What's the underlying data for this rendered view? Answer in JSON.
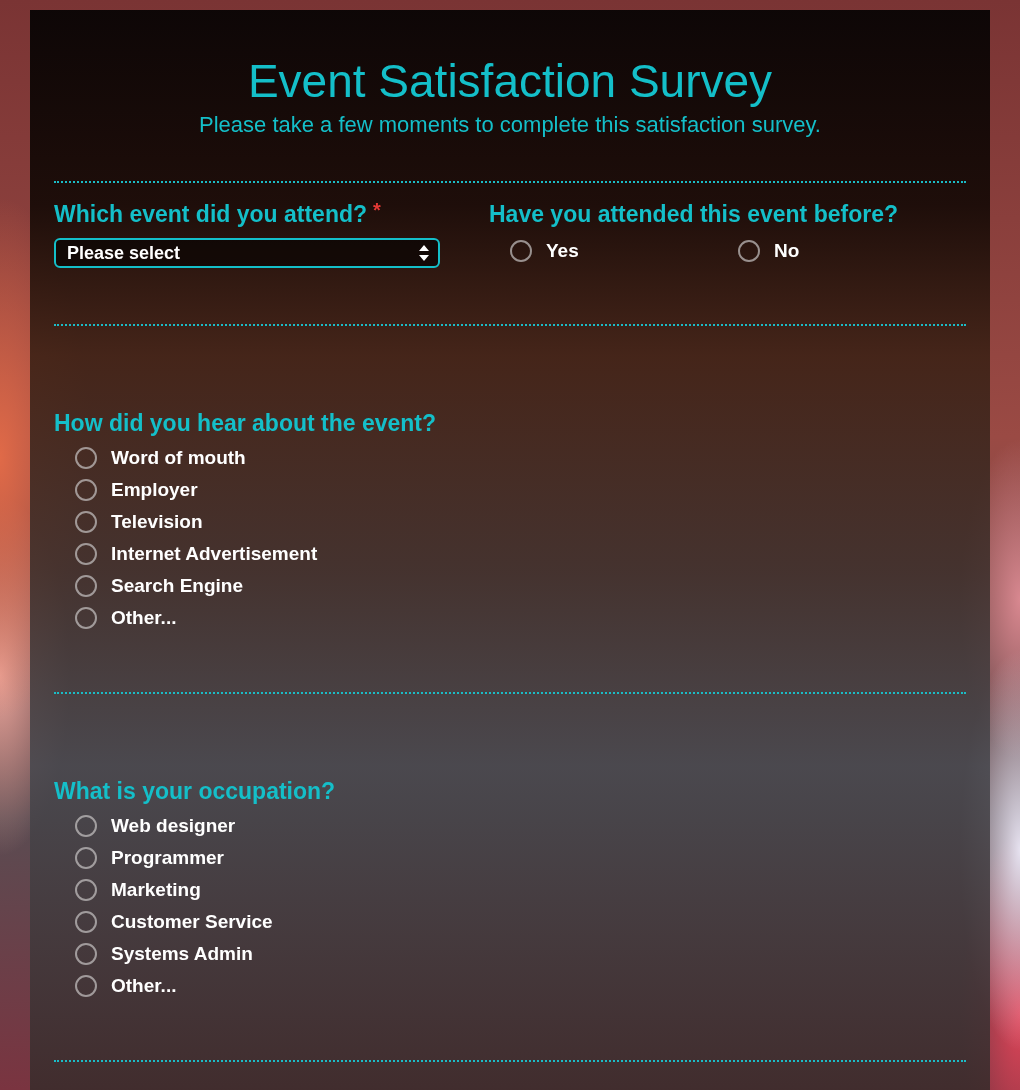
{
  "form": {
    "title": "Event Satisfaction Survey",
    "subtitle": "Please take a few moments to complete this satisfaction survey.",
    "sections": [
      {
        "questions": [
          {
            "kind": "select",
            "label": "Which event did you attend?",
            "required_mark": "*",
            "select": {
              "value": "Please select"
            }
          },
          {
            "kind": "radio_inline",
            "label": "Have you attended this event before?",
            "options": [
              {
                "label": "Yes",
                "selected": false
              },
              {
                "label": "No",
                "selected": false
              }
            ]
          }
        ]
      },
      {
        "questions": [
          {
            "kind": "radio_list",
            "label": "How did you hear about the event?",
            "options": [
              {
                "label": "Word of mouth",
                "selected": false
              },
              {
                "label": "Employer",
                "selected": false
              },
              {
                "label": "Television",
                "selected": false
              },
              {
                "label": "Internet Advertisement",
                "selected": false
              },
              {
                "label": "Search Engine",
                "selected": false
              },
              {
                "label": "Other...",
                "selected": false
              }
            ]
          }
        ]
      },
      {
        "questions": [
          {
            "kind": "radio_list",
            "label": "What is your occupation?",
            "options": [
              {
                "label": "Web designer",
                "selected": false
              },
              {
                "label": "Programmer",
                "selected": false
              },
              {
                "label": "Marketing",
                "selected": false
              },
              {
                "label": "Customer Service",
                "selected": false
              },
              {
                "label": "Systems Admin",
                "selected": false
              },
              {
                "label": "Other...",
                "selected": false
              }
            ]
          }
        ]
      }
    ]
  }
}
